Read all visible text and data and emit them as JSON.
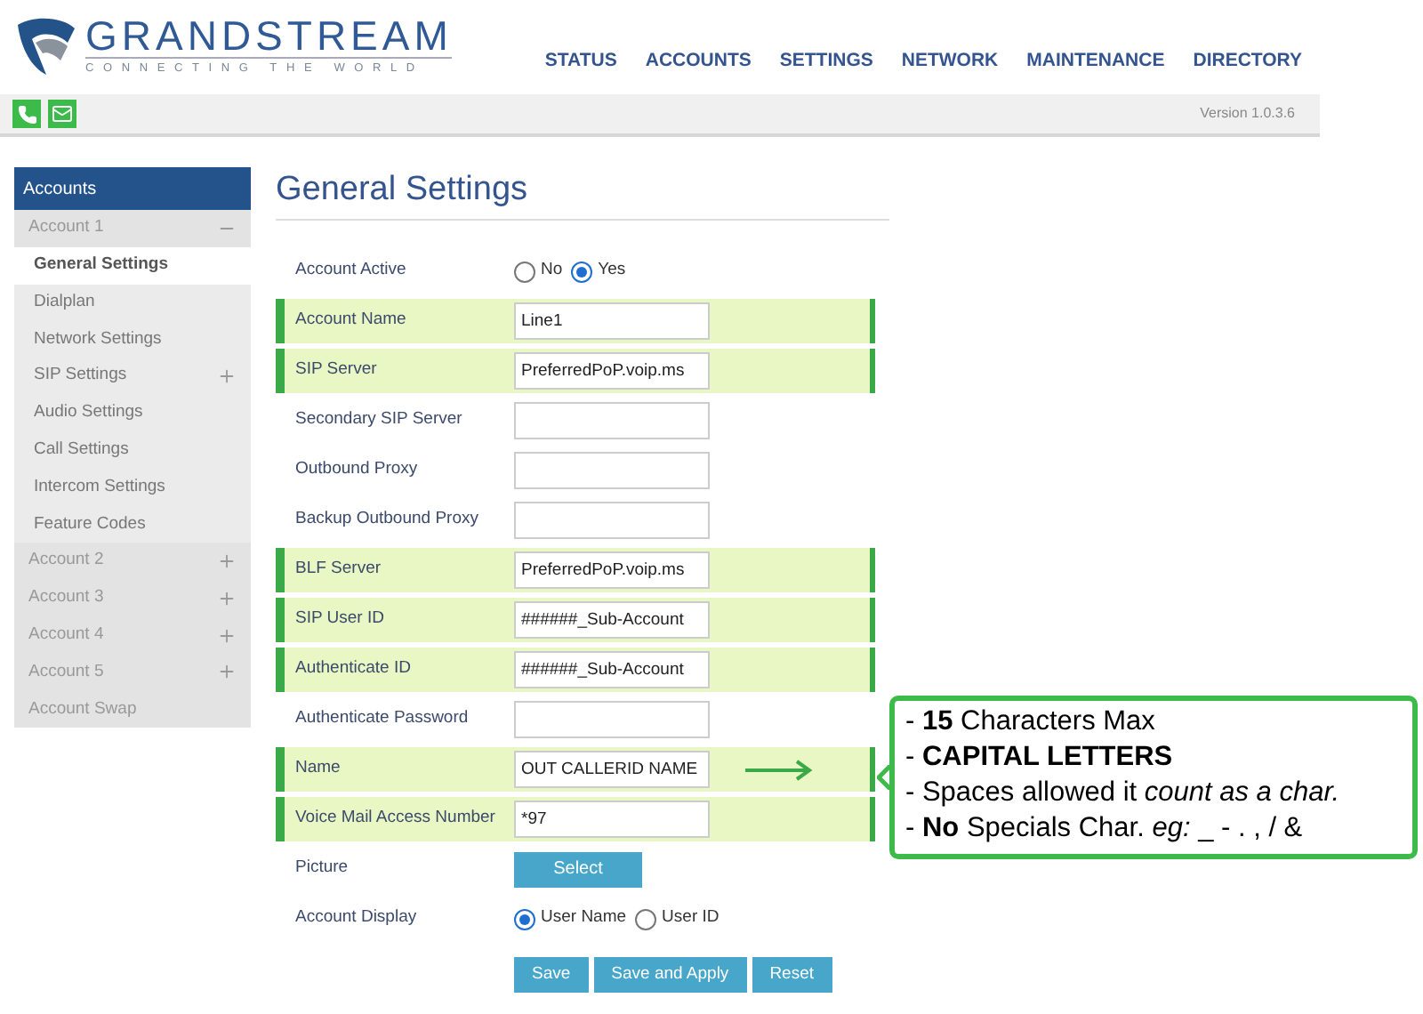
{
  "brand": {
    "name": "GRANDSTREAM",
    "tagline": "CONNECTING THE WORLD"
  },
  "nav": [
    "STATUS",
    "ACCOUNTS",
    "SETTINGS",
    "NETWORK",
    "MAINTENANCE",
    "DIRECTORY"
  ],
  "version": "Version 1.0.3.6",
  "sidebar": {
    "title": "Accounts",
    "items": [
      {
        "label": "Account 1",
        "kind": "group",
        "expanded": true,
        "selected": false,
        "children": [
          {
            "label": "General Settings",
            "kind": "link",
            "selected": true
          },
          {
            "label": "Dialplan",
            "kind": "link",
            "selected": false
          },
          {
            "label": "Network Settings",
            "kind": "link",
            "selected": false
          },
          {
            "label": "SIP Settings",
            "kind": "group",
            "expanded": false,
            "selected": false
          },
          {
            "label": "Audio Settings",
            "kind": "link",
            "selected": false
          },
          {
            "label": "Call Settings",
            "kind": "link",
            "selected": false
          },
          {
            "label": "Intercom Settings",
            "kind": "link",
            "selected": false
          },
          {
            "label": "Feature Codes",
            "kind": "link",
            "selected": false
          }
        ]
      },
      {
        "label": "Account 2",
        "kind": "group",
        "expanded": false,
        "selected": false
      },
      {
        "label": "Account 3",
        "kind": "group",
        "expanded": false,
        "selected": false
      },
      {
        "label": "Account 4",
        "kind": "group",
        "expanded": false,
        "selected": false
      },
      {
        "label": "Account 5",
        "kind": "group",
        "expanded": false,
        "selected": false
      },
      {
        "label": "Account Swap",
        "kind": "link",
        "selected": false
      }
    ]
  },
  "page_title": "General Settings",
  "form": [
    {
      "label": "Account Active",
      "kind": "radio",
      "highlighted": false,
      "options": [
        {
          "label": "No",
          "selected": false
        },
        {
          "label": "Yes",
          "selected": true
        }
      ]
    },
    {
      "label": "Account Name",
      "kind": "text",
      "highlighted": true,
      "value": "Line1"
    },
    {
      "label": "SIP Server",
      "kind": "text",
      "highlighted": true,
      "value": "PreferredPoP.voip.ms"
    },
    {
      "label": "Secondary SIP Server",
      "kind": "text",
      "highlighted": false
    },
    {
      "label": "Outbound Proxy",
      "kind": "text",
      "highlighted": false
    },
    {
      "label": "Backup Outbound Proxy",
      "kind": "text",
      "highlighted": false
    },
    {
      "label": "BLF Server",
      "kind": "text",
      "highlighted": true,
      "value": "PreferredPoP.voip.ms"
    },
    {
      "label": "SIP User ID",
      "kind": "text",
      "highlighted": true,
      "value": "######_Sub-Account"
    },
    {
      "label": "Authenticate ID",
      "kind": "text",
      "highlighted": true,
      "value": "######_Sub-Account"
    },
    {
      "label": "Authenticate Password",
      "kind": "text",
      "highlighted": false
    },
    {
      "label": "Name",
      "kind": "text",
      "highlighted": true,
      "value": "OUT CALLERID NAME",
      "arrow": true
    },
    {
      "label": "Voice Mail Access Number",
      "kind": "text",
      "highlighted": true,
      "value": "*97"
    },
    {
      "label": "Picture",
      "kind": "button",
      "highlighted": false,
      "button": "Select"
    },
    {
      "label": "Account Display",
      "kind": "radio",
      "highlighted": false,
      "options": [
        {
          "label": "User Name",
          "selected": true
        },
        {
          "label": "User ID",
          "selected": false
        }
      ]
    }
  ],
  "actions": [
    "Save",
    "Save and Apply",
    "Reset"
  ],
  "note": [
    "- **15** Characters Max",
    "- **CAPITAL LETTERS**",
    "- Spaces allowed it *count as a char.*",
    "- **No** Specials Char. *eg:* _ - . , / &"
  ]
}
